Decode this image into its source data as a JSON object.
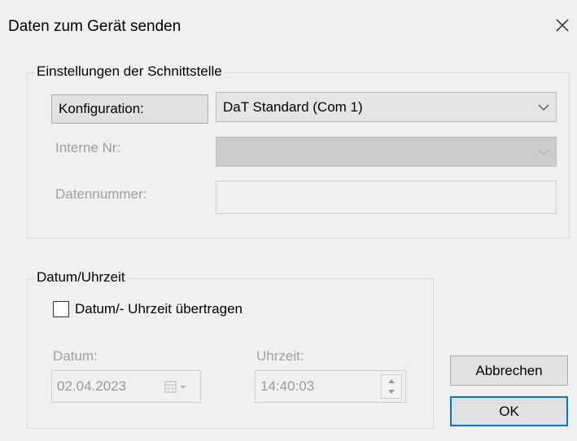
{
  "window": {
    "title": "Daten zum Gerät senden"
  },
  "interface_group": {
    "legend": "Einstellungen der Schnittstelle",
    "konfiguration_label": "Konfiguration:",
    "konfiguration_value": "DaT Standard (Com 1)",
    "interne_nr_label": "Interne Nr:",
    "interne_nr_value": "",
    "datennummer_label": "Datennummer:",
    "datennummer_value": ""
  },
  "datetime_group": {
    "legend": "Datum/Uhrzeit",
    "checkbox_label": "Datum/- Uhrzeit übertragen",
    "checkbox_checked": false,
    "datum_label": "Datum:",
    "datum_value": "02.04.2023",
    "uhrzeit_label": "Uhrzeit:",
    "uhrzeit_value": "14:40:03"
  },
  "buttons": {
    "cancel": "Abbrechen",
    "ok": "OK"
  },
  "colors": {
    "window_bg": "#f0f0f0",
    "disabled_text": "#a0a0a0",
    "focus_border": "#0078d7"
  }
}
